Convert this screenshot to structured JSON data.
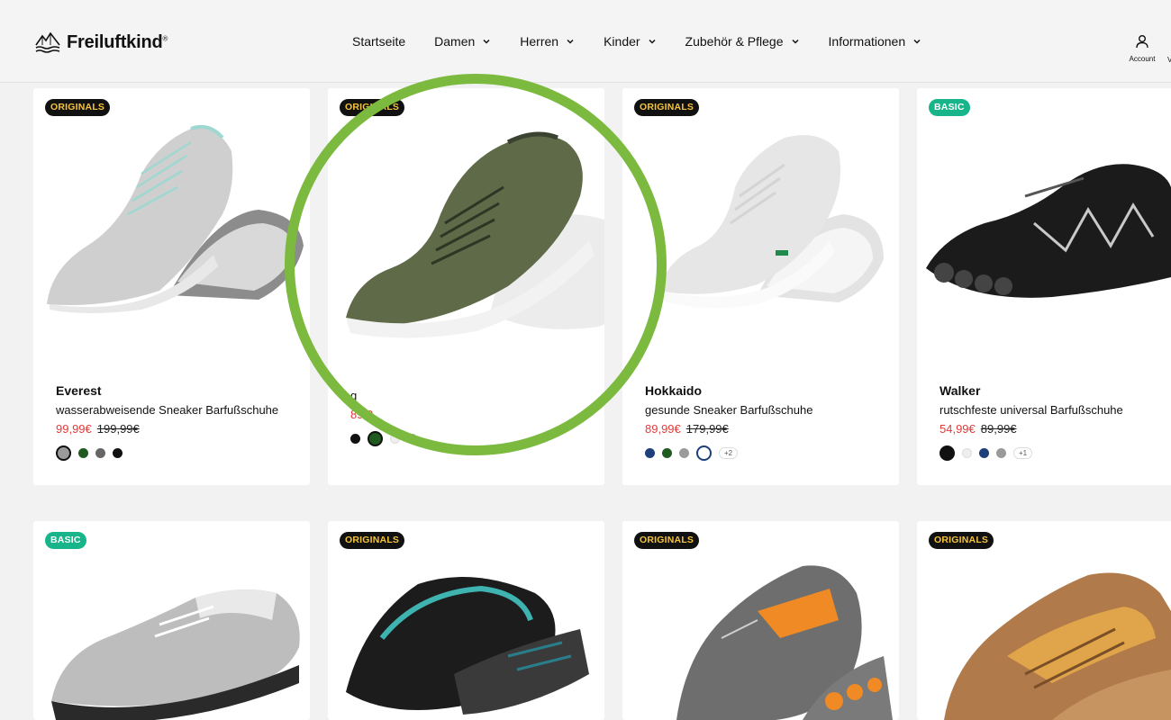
{
  "brand": {
    "name": "Freiluftkind",
    "reg": "®"
  },
  "nav": [
    {
      "label": "Startseite",
      "has_dropdown": false
    },
    {
      "label": "Damen",
      "has_dropdown": true
    },
    {
      "label": "Herren",
      "has_dropdown": true
    },
    {
      "label": "Kinder",
      "has_dropdown": true
    },
    {
      "label": "Zubehör & Pflege",
      "has_dropdown": true
    },
    {
      "label": "Informationen",
      "has_dropdown": true
    }
  ],
  "account": {
    "label": "Account"
  },
  "header_edge_text": "V",
  "colors": {
    "sale": "#e33a3a",
    "originals_bg": "#111111",
    "originals_text": "#f5c43b",
    "basic_bg": "#18b48a",
    "highlight": "#7cba3f"
  },
  "products_row1": [
    {
      "badge": "ORIGINALS",
      "badge_type": "originals",
      "name": "Everest",
      "desc": "wasserabweisende Sneaker Barfußschuhe",
      "price": "99,99€",
      "old_price": "199,99€",
      "swatches": [
        "#9a9a9a",
        "#1f5a1f",
        "#666666",
        "#111111"
      ],
      "selected": 0,
      "more": ""
    },
    {
      "badge": "ORIGINALS",
      "badge_type": "originals",
      "name": "",
      "desc": "g",
      "price": "89,9",
      "old_price": "",
      "swatches": [
        "#111111",
        "#1f5a1f",
        "#eeeeee",
        "#9a9a9a"
      ],
      "selected": 1,
      "more": ""
    },
    {
      "badge": "ORIGINALS",
      "badge_type": "originals",
      "name": "Hokkaido",
      "desc": "gesunde Sneaker Barfußschuhe",
      "price": "89,99€",
      "old_price": "179,99€",
      "swatches": [
        "#1e3f7a",
        "#1f5a1f",
        "#9a9a9a",
        "#ffffff"
      ],
      "selected": 3,
      "more": "+2"
    },
    {
      "badge": "BASIC",
      "badge_type": "basic",
      "name": "Walker",
      "desc": "rutschfeste universal Barfußschuhe",
      "price": "54,99€",
      "old_price": "89,99€",
      "swatches": [
        "#111111",
        "#eeeeee",
        "#1e3f7a",
        "#9a9a9a"
      ],
      "selected": 0,
      "more": "+1"
    }
  ],
  "products_row2": [
    {
      "badge": "BASIC",
      "badge_type": "basic"
    },
    {
      "badge": "ORIGINALS",
      "badge_type": "originals"
    },
    {
      "badge": "ORIGINALS",
      "badge_type": "originals"
    },
    {
      "badge": "ORIGINALS",
      "badge_type": "originals"
    }
  ]
}
